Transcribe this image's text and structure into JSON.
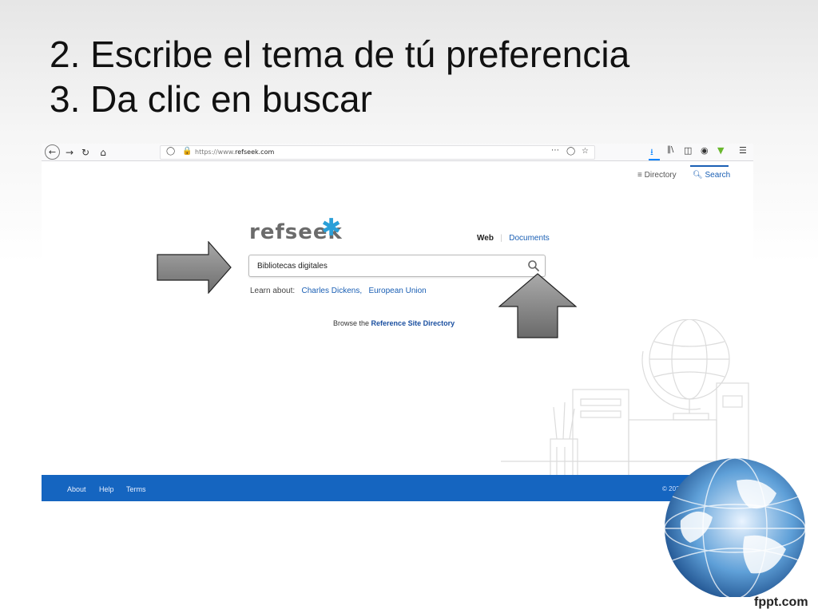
{
  "slide": {
    "title_line1": "2. Escribe el tema de tú preferencia",
    "title_line2": "3. Da clic en buscar",
    "watermark": "fppt.com"
  },
  "browser": {
    "url_prefix": "https://www.",
    "url_domain": "refseek.com",
    "icons": [
      "back-icon",
      "forward-icon",
      "reload-icon",
      "home-icon",
      "shield-icon",
      "lock-icon",
      "more-icon",
      "pocket-icon",
      "star-icon",
      "download-icon",
      "library-icon",
      "sidebar-icon",
      "account-icon",
      "extension-icon",
      "menu-icon"
    ]
  },
  "page": {
    "nav": {
      "directory": "Directory",
      "search": "Search"
    },
    "logo": "refseek",
    "modes": {
      "web": "Web",
      "separator": "|",
      "documents": "Documents"
    },
    "search": {
      "value": "Bibliotecas digitales"
    },
    "learn": {
      "label": "Learn about:",
      "link1": "Charles Dickens,",
      "link2": "European Union"
    },
    "browse": {
      "prefix": "Browse the",
      "link": "Reference Site Directory"
    },
    "footer": {
      "about": "About",
      "help": "Help",
      "terms": "Terms",
      "copyright": "© 2020 RefSeek.com"
    }
  },
  "colors": {
    "accent": "#1a5fb4",
    "footer": "#1565c0",
    "logo_star": "#2a9fd8",
    "arrow": "#7d7d7d"
  }
}
